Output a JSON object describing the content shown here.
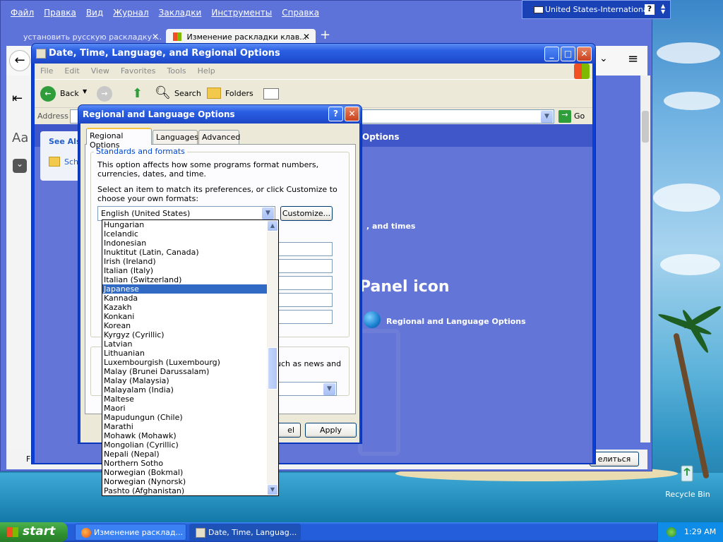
{
  "language_bar": {
    "label": "United States-International"
  },
  "firefox": {
    "menu": [
      "Файл",
      "Правка",
      "Вид",
      "Журнал",
      "Закладки",
      "Инструменты",
      "Справка"
    ],
    "tabs": [
      {
        "label": "установить русскую раскладку ..."
      },
      {
        "label": "Изменение раскладки клав..."
      }
    ],
    "share_button": "елиться",
    "status_prefix": "F"
  },
  "explorer": {
    "title": "Date, Time, Language, and Regional Options",
    "menu": [
      "File",
      "Edit",
      "View",
      "Favorites",
      "Tools",
      "Help"
    ],
    "toolbar": {
      "back": "Back",
      "search": "Search",
      "folders": "Folders"
    },
    "address_label": "Address",
    "go_label": "Go",
    "see_also": "See Als",
    "see_also_item": "Sch",
    "header_text": "Options",
    "task_text": ", and times",
    "panel_icon_text": "Panel icon",
    "regional_link": "Regional and Language Options"
  },
  "dialog": {
    "title": "Regional and Language Options",
    "tabs": [
      "Regional Options",
      "Languages",
      "Advanced"
    ],
    "group_standards": "Standards and formats",
    "desc1": "This option affects how some programs format numbers, currencies, dates, and time.",
    "desc2": "Select an item to match its preferences, or click Customize to choose your own formats:",
    "selected_locale": "English (United States)",
    "customize": "Customize...",
    "location_desc_fragment": "uch as news and",
    "cancel_fragment": "el",
    "apply": "Apply"
  },
  "dropdown": {
    "items": [
      "Hungarian",
      "Icelandic",
      "Indonesian",
      "Inuktitut (Latin, Canada)",
      "Irish (Ireland)",
      "Italian (Italy)",
      "Italian (Switzerland)",
      "Japanese",
      "Kannada",
      "Kazakh",
      "Konkani",
      "Korean",
      "Kyrgyz (Cyrillic)",
      "Latvian",
      "Lithuanian",
      "Luxembourgish (Luxembourg)",
      "Malay (Brunei Darussalam)",
      "Malay (Malaysia)",
      "Malayalam (India)",
      "Maltese",
      "Maori",
      "Mapudungun (Chile)",
      "Marathi",
      "Mohawk (Mohawk)",
      "Mongolian (Cyrillic)",
      "Nepali (Nepal)",
      "Northern Sotho",
      "Norwegian (Bokmal)",
      "Norwegian (Nynorsk)",
      "Pashto (Afghanistan)"
    ],
    "selected": "Japanese"
  },
  "desktop": {
    "recycle_bin": "Recycle Bin"
  },
  "taskbar": {
    "start": "start",
    "tasks": [
      {
        "label": "Изменение расклад..."
      },
      {
        "label": "Date, Time, Languag..."
      }
    ],
    "clock": "1:29 AM"
  }
}
